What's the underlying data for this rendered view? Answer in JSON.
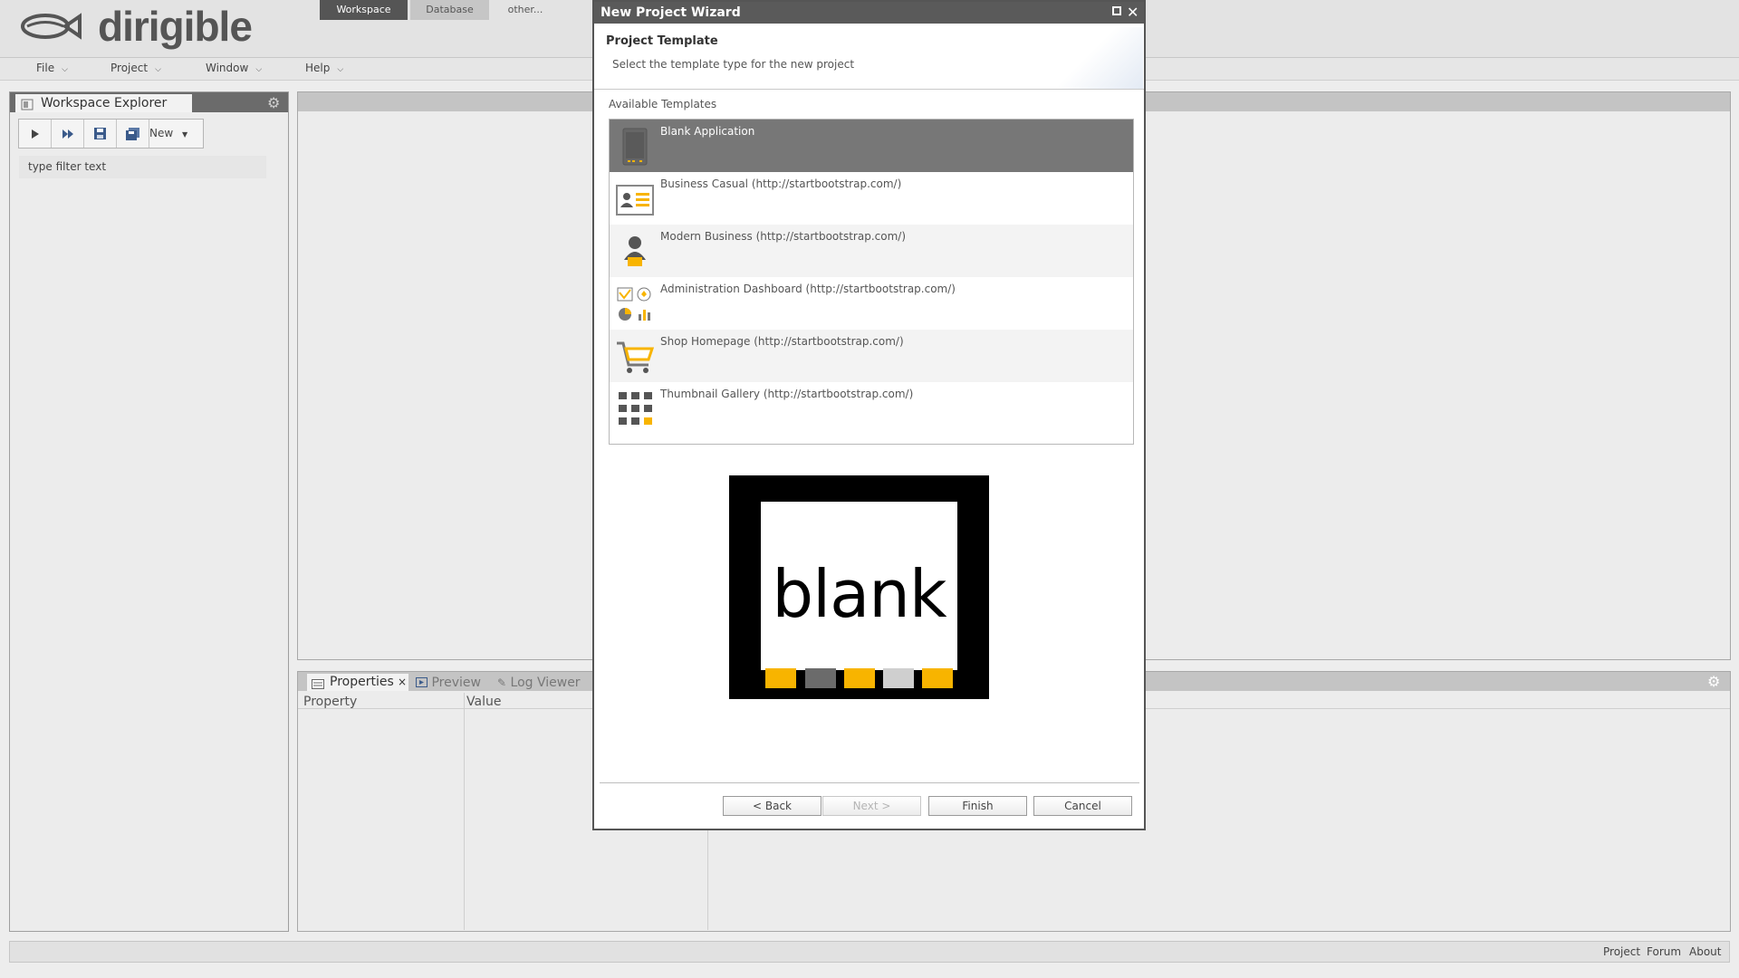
{
  "header": {
    "logo_text": "dirigible",
    "perspectives": [
      {
        "label": "Workspace",
        "active": true
      },
      {
        "label": "Database",
        "active": false
      },
      {
        "label": "other...",
        "active": false
      }
    ]
  },
  "menubar": {
    "items": [
      "File",
      "Project",
      "Window",
      "Help"
    ]
  },
  "workspace_explorer": {
    "title": "Workspace Explorer",
    "new_label": "New",
    "filter_text": "type filter text"
  },
  "bottom_panel": {
    "tabs": [
      {
        "label": "Properties",
        "close": "×"
      },
      {
        "label": "Preview"
      },
      {
        "label": "Log Viewer"
      }
    ],
    "columns": [
      "Property",
      "Value"
    ]
  },
  "statusbar": {
    "links": [
      "Project",
      "Forum",
      "About"
    ]
  },
  "dialog": {
    "title": "New Project Wizard",
    "header_title": "Project Template",
    "header_desc": "Select the template type for the new project",
    "list_label": "Available Templates",
    "templates": [
      {
        "name": "Blank Application",
        "icon": "blank-app-icon",
        "selected": true
      },
      {
        "name": "Business Casual (http://startbootstrap.com/)",
        "icon": "business-card-icon",
        "selected": false
      },
      {
        "name": "Modern Business (http://startbootstrap.com/)",
        "icon": "person-icon",
        "selected": false
      },
      {
        "name": "Administration Dashboard (http://startbootstrap.com/)",
        "icon": "dashboard-charts-icon",
        "selected": false
      },
      {
        "name": "Shop Homepage (http://startbootstrap.com/)",
        "icon": "shopping-cart-icon",
        "selected": false
      },
      {
        "name": "Thumbnail Gallery (http://startbootstrap.com/)",
        "icon": "grid-gallery-icon",
        "selected": false
      }
    ],
    "preview_text": "blank",
    "buttons": {
      "back": "< Back",
      "next": "Next >",
      "finish": "Finish",
      "cancel": "Cancel"
    }
  },
  "colors": {
    "accent_yellow": "#f8b400",
    "dark_gray": "#6b6b6b",
    "selected_row": "#777777",
    "active_tab": "#555555"
  }
}
